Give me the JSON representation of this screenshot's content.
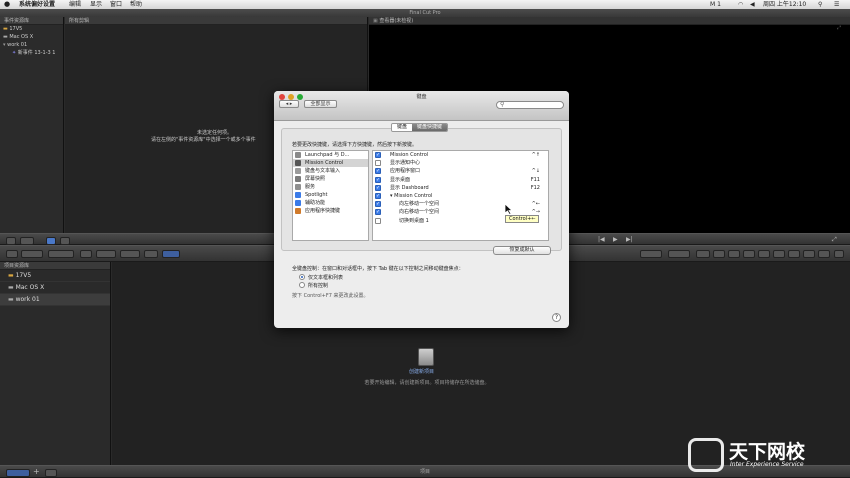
{
  "menubar": {
    "apple": "",
    "items": [
      "系统偏好设置",
      "编辑",
      "显示",
      "窗口",
      "帮助"
    ],
    "status": {
      "m": "M 1",
      "clock": "周四 上午12:10"
    }
  },
  "app_title": "Final Cut Pro",
  "event_library": {
    "header": "事件资源库",
    "items": [
      "17V5",
      "Mac OS X",
      "work 01",
      "新事件 13-1-3 1"
    ]
  },
  "event_browser": {
    "header": "所有剪辑",
    "empty_title": "未选定任何项。",
    "empty_hint": "请在左侧的\"事件资源库\"中选择一个或多个事件"
  },
  "viewer": {
    "header": "查看器(未检视)"
  },
  "project_library": {
    "header": "项目资源库",
    "items": [
      "17V5",
      "Mac OS X",
      "work 01"
    ]
  },
  "project_area": {
    "new_label": "创建新项目",
    "hint": "若要开始编辑，请创建新项目。项目将储存在所选储盘。"
  },
  "bottom": {
    "label": "项目"
  },
  "watermark": {
    "cn": "天下网校",
    "en": "Inter Experience Service"
  },
  "dialog": {
    "title": "键盘",
    "show_all": "全部显示",
    "tabs": [
      "键盘",
      "键盘快捷键"
    ],
    "instruction": "若要更改快捷键，请选择下方快捷键，然后按下新按键。",
    "categories": [
      {
        "label": "Launchpad 与 D...",
        "icon": "launchpad-icon",
        "color": "#8a8a8a"
      },
      {
        "label": "Mission Control",
        "icon": "mission-control-icon",
        "color": "#555555"
      },
      {
        "label": "键盘与文本输入",
        "icon": "keyboard-icon",
        "color": "#9a9a9a"
      },
      {
        "label": "屏幕快照",
        "icon": "screenshot-icon",
        "color": "#7a7a7a"
      },
      {
        "label": "服务",
        "icon": "gear-icon",
        "color": "#8f8f8f"
      },
      {
        "label": "Spotlight",
        "icon": "spotlight-icon",
        "color": "#3b7be8"
      },
      {
        "label": "辅助功能",
        "icon": "accessibility-icon",
        "color": "#3b7be8"
      },
      {
        "label": "应用程序快捷键",
        "icon": "app-shortcuts-icon",
        "color": "#d07a2a"
      }
    ],
    "shortcuts": [
      {
        "label": "Mission Control",
        "key": "^↑",
        "checked": true,
        "indent": 0
      },
      {
        "label": "显示通知中心",
        "key": "",
        "checked": false,
        "indent": 0
      },
      {
        "label": "应用程序窗口",
        "key": "^↓",
        "checked": true,
        "indent": 0
      },
      {
        "label": "显示桌面",
        "key": "F11",
        "checked": true,
        "indent": 0
      },
      {
        "label": "显示 Dashboard",
        "key": "F12",
        "checked": true,
        "indent": 0
      },
      {
        "label": "▾ Mission Control",
        "key": "",
        "checked": true,
        "indent": 0
      },
      {
        "label": "向左移动一个空间",
        "key": "^←",
        "checked": true,
        "indent": 1
      },
      {
        "label": "向右移动一个空间",
        "key": "^→",
        "checked": true,
        "indent": 1
      },
      {
        "label": "切换到桌面 1",
        "key": "",
        "checked": false,
        "indent": 1
      }
    ],
    "restore_button": "恢复成默认",
    "full_kb_label": "全键盘控制：在窗口和对话框中，按下 Tab 键在以下控制之间移动键盘焦点：",
    "radio_options": [
      {
        "label": "仅文本框和列表",
        "selected": true
      },
      {
        "label": "所有控制",
        "selected": false
      }
    ],
    "footnote": "按下 Control+F7 来更改此设置。",
    "help": "?"
  },
  "tooltip": "Control+←"
}
